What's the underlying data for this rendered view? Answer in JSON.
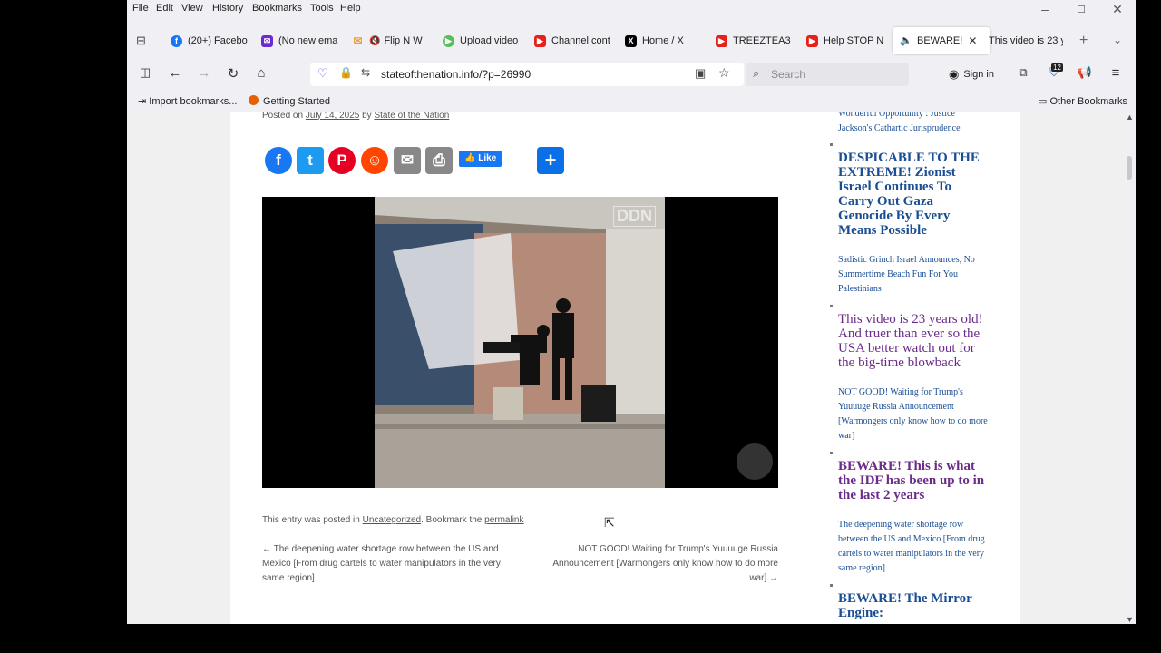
{
  "menu": [
    "File",
    "Edit",
    "View",
    "History",
    "Bookmarks",
    "Tools",
    "Help"
  ],
  "tabs": [
    {
      "label": "(20+) Facebo",
      "icon": "facebook-icon",
      "color": "#1877f2"
    },
    {
      "label": "(No new ema",
      "icon": "mail-icon",
      "color": "#6a2bd1"
    },
    {
      "label": "Flip N W",
      "icon": "mute-icon",
      "color": "#e8a040"
    },
    {
      "label": "Upload video",
      "icon": "play-icon",
      "color": "#55c05a"
    },
    {
      "label": "Channel cont",
      "icon": "youtube-icon",
      "color": "#e62117"
    },
    {
      "label": "Home / X",
      "icon": "x-logo-icon",
      "color": "#000000"
    },
    {
      "label": "TREEZTEA3 -",
      "icon": "youtube-icon",
      "color": "#e62117"
    },
    {
      "label": "Help STOP N",
      "icon": "youtube-icon",
      "color": "#e62117"
    },
    {
      "label": "BEWARE!",
      "icon": "audio-icon",
      "color": "#333333"
    },
    {
      "label": "This video is 23 y",
      "icon": "",
      "color": ""
    }
  ],
  "nav": {
    "url": "stateofthenation.info/?p=26990",
    "search_placeholder": "Search",
    "signin": "Sign in",
    "badge": "12"
  },
  "bookmarks": {
    "import": "Import bookmarks...",
    "getting_started": "Getting Started",
    "other": "Other Bookmarks"
  },
  "post": {
    "meta_prefix": "Posted on",
    "date": "July 14, 2025",
    "meta_by": "by",
    "author": "State of the Nation",
    "fb_like": "Like",
    "video_watermark": "DDN",
    "entry_prefix": "This entry was posted in",
    "category": "Uncategorized",
    "entry_mid": ". Bookmark the",
    "permalink": "permalink",
    "prev_link": "← The deepening water shortage row between the US and Mexico [From drug cartels to water manipulators in the very same region]",
    "next_link": "NOT GOOD! Waiting for Trump's Yuuuuge Russia Announcement [Warmongers only know how to do more war] →"
  },
  "sidebar": {
    "top_cut": "Wonderful Opportunity : Justice Jackson's Cathartic Jurisprudence",
    "items": [
      {
        "title": "DESPICABLE TO THE EXTREME! Zionist Israel Continues To Carry Out Gaza Genocide By Every Means Possible",
        "sub": "Sadistic Grinch Israel Announces, No Summertime Beach Fun For You Palestinians",
        "color": "#1a4e94"
      },
      {
        "title": "This video is 23 years old! And truer than ever so the USA better watch out for the big-time blowback",
        "sub": "NOT GOOD! Waiting for Trump's Yuuuuge Russia Announcement [Warmongers only know how to do more war]",
        "color": "#6b2b8a"
      },
      {
        "title": "BEWARE! This is what the IDF has been up to in the last 2 years",
        "sub": "The deepening water shortage row between the US and Mexico [From drug cartels to water manipulators in the very same region]",
        "color": "#6b2b8a"
      },
      {
        "title": "BEWARE! The Mirror Engine:",
        "sub": "",
        "color": "#1a4e94"
      }
    ]
  }
}
